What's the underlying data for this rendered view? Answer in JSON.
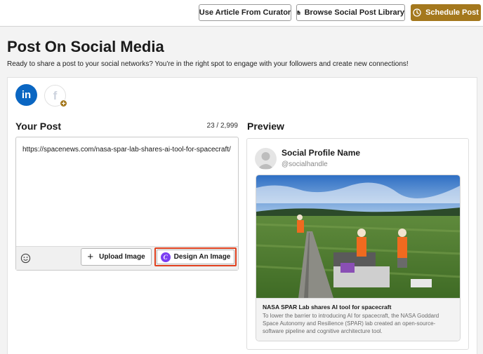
{
  "toolbar": {
    "curator_label": "Use Article From Curator",
    "library_label": "Browse Social Post Library",
    "schedule_label": "Schedule Post",
    "accent_color": "#a4781d"
  },
  "page": {
    "title": "Post On Social Media",
    "subtitle": "Ready to share a post to your social networks? You're in the right spot to engage with your followers and create new connections!"
  },
  "networks": [
    {
      "name": "linkedin",
      "glyph": "in",
      "icon": "linkedin-icon",
      "color": "#0a66c2"
    },
    {
      "name": "facebook",
      "glyph": "f",
      "icon": "facebook-icon",
      "badge": "+"
    }
  ],
  "composer": {
    "heading": "Your Post",
    "counter": "23 / 2,999",
    "text": "https://spacenews.com/nasa-spar-lab-shares-ai-tool-for-spacecraft/",
    "upload_label": "Upload Image",
    "design_label": "Design An Image",
    "canva_glyph": "C"
  },
  "preview": {
    "heading": "Preview",
    "profile_name": "Social Profile Name",
    "handle": "@socialhandle",
    "link_title": "NASA SPAR Lab shares AI tool for spacecraft",
    "link_description": "To lower the barrier to introducing AI for spacecraft, the NASA Goddard Space Autonomy and Resilience (SPAR) lab created an open-source-software pipeline and cognitive architecture tool."
  }
}
